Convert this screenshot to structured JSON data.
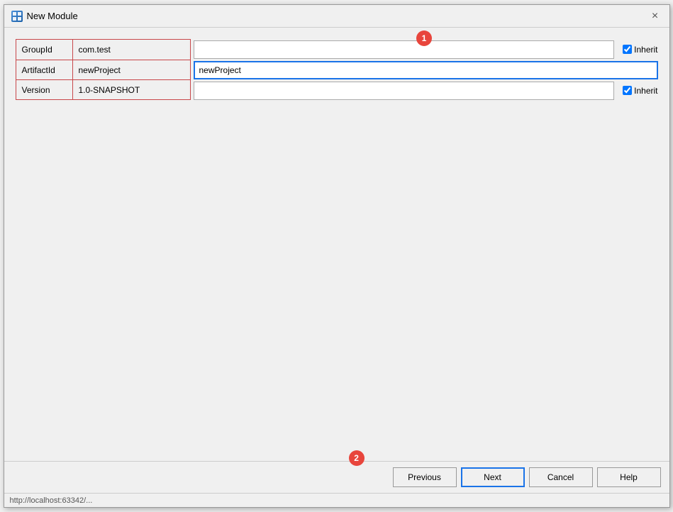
{
  "dialog": {
    "title": "New Module",
    "icon_label": "M",
    "close_button": "×"
  },
  "form": {
    "groupid_label": "GroupId",
    "groupid_value": "com.test",
    "artifactid_label": "ArtifactId",
    "artifactid_value": "newProject",
    "version_label": "Version",
    "version_value": "1.0-SNAPSHOT",
    "groupid_input_placeholder": "",
    "artifactid_input_placeholder": "",
    "version_input_placeholder": "",
    "inherit_label_1": "Inherit",
    "inherit_label_2": "Inherit"
  },
  "badges": {
    "badge1": "1",
    "badge2": "2"
  },
  "buttons": {
    "previous": "Previous",
    "next": "Next",
    "cancel": "Cancel",
    "help": "Help"
  },
  "status_bar": {
    "text": "http://localhost:63342/..."
  }
}
